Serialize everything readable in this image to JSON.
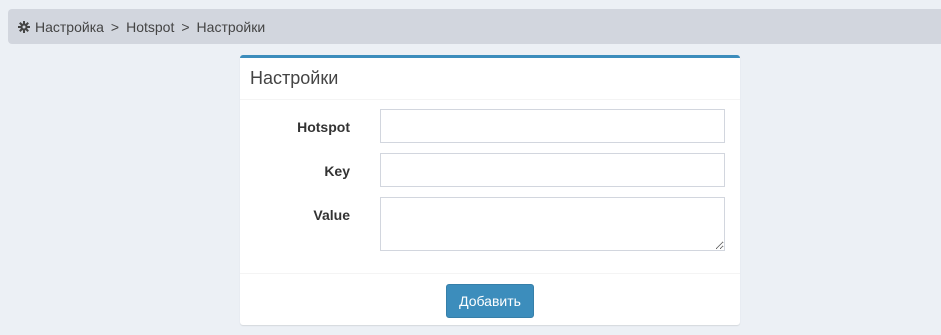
{
  "breadcrumb": {
    "icon": "gear-icon",
    "items": [
      "Настройка",
      "Hotspot",
      "Настройки"
    ],
    "separator": ">"
  },
  "box": {
    "title": "Настройки",
    "accent_color": "#3c8dbc"
  },
  "form": {
    "hotspot_label": "Hotspot",
    "hotspot_value": "",
    "key_label": "Key",
    "key_value": "",
    "value_label": "Value",
    "value_value": ""
  },
  "footer": {
    "submit_label": "Добавить"
  }
}
